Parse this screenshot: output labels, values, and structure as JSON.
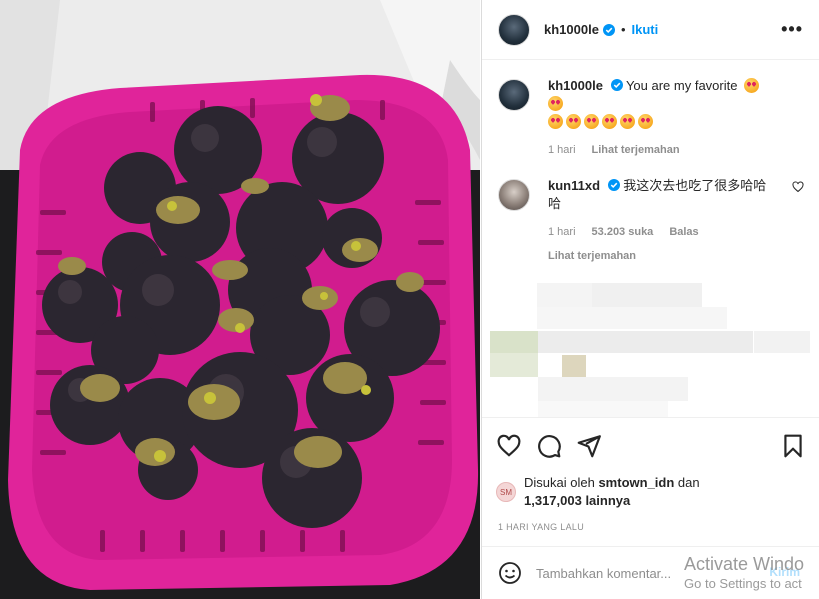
{
  "post": {
    "author": "kh1000le",
    "follow_label": "Ikuti",
    "separator": "•",
    "more_label": "•••"
  },
  "comments": [
    {
      "username": "kh1000le",
      "text": "You are my favorite",
      "emoji_count": 8,
      "time": "1 hari",
      "translate": "Lihat terjemahan"
    },
    {
      "username": "kun11xd",
      "text": "我这次去也吃了很多哈哈哈",
      "time": "1 hari",
      "likes": "53.203 suka",
      "reply": "Balas",
      "translate": "Lihat terjemahan"
    }
  ],
  "likes": {
    "prefix": "Disukai oleh",
    "user": "smtown_idn",
    "conjunction": "dan",
    "count": "1,317,003 lainnya"
  },
  "timestamp": "1 HARI YANG LALU",
  "add_comment": {
    "placeholder": "Tambahkan komentar...",
    "send_label": "Kirim"
  },
  "watermark": {
    "line1": "Activate Windo",
    "line2": "Go to Settings to act"
  },
  "colors": {
    "accent": "#0095f6",
    "basket": "#e0249a",
    "verified": "#0095f6"
  }
}
